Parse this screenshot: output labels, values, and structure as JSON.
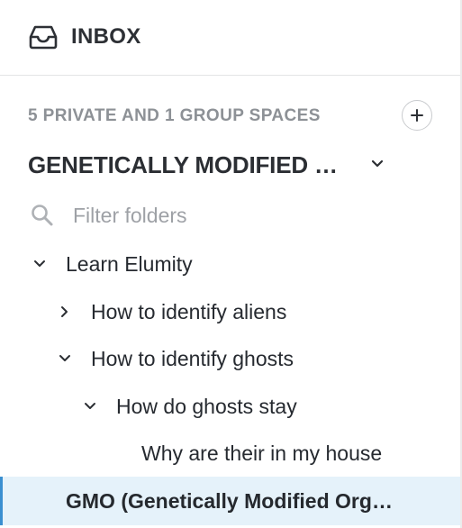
{
  "inbox": {
    "label": "INBOX",
    "icon": "inbox-tray-icon"
  },
  "spaces": {
    "count_label": "5 PRIVATE AND 1 GROUP SPACES",
    "add_icon": "plus-icon",
    "current_space": "GENETICALLY MODIFIED ORGANISMS",
    "current_space_display": "GENETICALLY MODIFIED O...",
    "dropdown_icon": "chevron-down-icon"
  },
  "filter": {
    "placeholder": "Filter folders",
    "value": "",
    "icon": "search-icon"
  },
  "tree": [
    {
      "label": "Learn Elumity",
      "level": 0,
      "expanded": true,
      "has_children": true
    },
    {
      "label": "How to identify aliens",
      "level": 1,
      "expanded": false,
      "has_children": true
    },
    {
      "label": "How to identify ghosts",
      "level": 1,
      "expanded": true,
      "has_children": true
    },
    {
      "label": "How do ghosts stay",
      "level": 2,
      "expanded": true,
      "has_children": true
    },
    {
      "label": "Why are their in my house",
      "level": 3,
      "expanded": false,
      "has_children": false
    },
    {
      "label": "GMO (Genetically Modified Orga...",
      "level": 0,
      "expanded": false,
      "has_children": false,
      "selected": true
    }
  ],
  "colors": {
    "accent": "#3a8fd0",
    "selected_bg": "#e5f2fa",
    "muted_text": "#8d9196",
    "text": "#262a30"
  }
}
